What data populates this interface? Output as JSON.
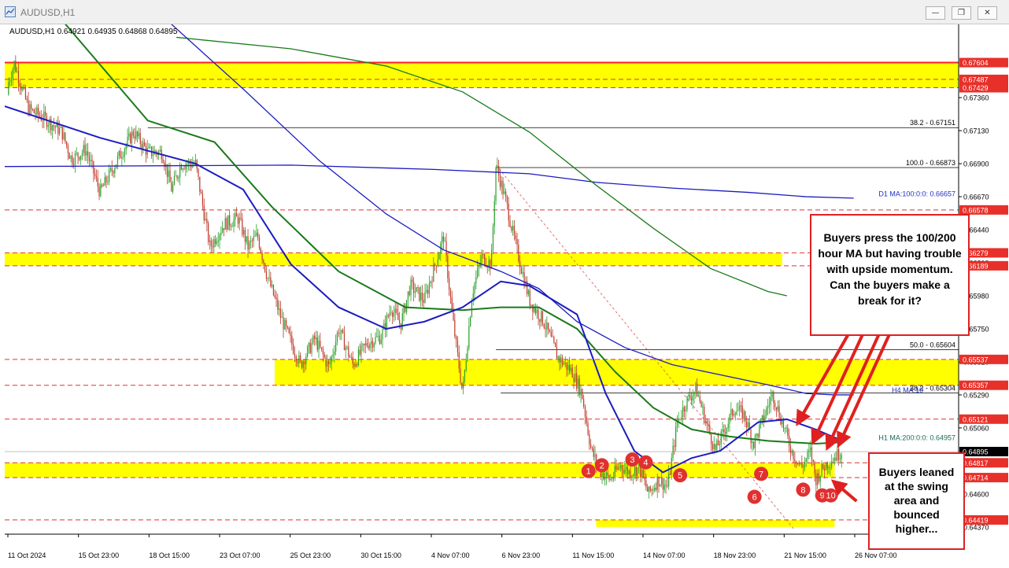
{
  "window": {
    "title": "AUDUSD,H1",
    "minimize_glyph": "—",
    "restore_glyph": "❐",
    "close_glyph": "✕",
    "icon": "chart-window-icon"
  },
  "chart_data": {
    "type": "candlestick",
    "symbol_info": "AUDUSD,H1  0.64921 0.64935 0.64868 0.64895",
    "y_range": [
      0.6432,
      0.6787
    ],
    "price_ticks": [
      {
        "label": "0.67360",
        "value": 0.6736
      },
      {
        "label": "0.67130",
        "value": 0.6713
      },
      {
        "label": "0.66900",
        "value": 0.669
      },
      {
        "label": "0.66670",
        "value": 0.6667
      },
      {
        "label": "0.66440",
        "value": 0.6644
      },
      {
        "label": "0.66210",
        "value": 0.6621
      },
      {
        "label": "0.65980",
        "value": 0.6598
      },
      {
        "label": "0.65750",
        "value": 0.6575
      },
      {
        "label": "0.65520",
        "value": 0.6552
      },
      {
        "label": "0.65290",
        "value": 0.6529
      },
      {
        "label": "0.65060",
        "value": 0.6506
      },
      {
        "label": "0.64830",
        "value": 0.6483
      },
      {
        "label": "0.64600",
        "value": 0.646
      },
      {
        "label": "0.64370",
        "value": 0.6437
      }
    ],
    "price_levels": [
      {
        "label": "0.67604",
        "value": 0.67604,
        "color": "#ff2020",
        "style": "solid"
      },
      {
        "label": "0.67487",
        "value": 0.67487,
        "color": "#e03030",
        "style": "dashed"
      },
      {
        "label": "0.67429",
        "value": 0.67429,
        "color": "#e03030",
        "style": "dashed"
      },
      {
        "label": "0.66578",
        "value": 0.66578,
        "color": "#e03030",
        "style": "dashed"
      },
      {
        "label": "0.66279",
        "value": 0.66279,
        "color": "#e03030",
        "style": "dashed"
      },
      {
        "label": "0.66189",
        "value": 0.66189,
        "color": "#e03030",
        "style": "dashed"
      },
      {
        "label": "0.65537",
        "value": 0.65537,
        "color": "#e03030",
        "style": "dashed"
      },
      {
        "label": "0.65357",
        "value": 0.65357,
        "color": "#e03030",
        "style": "dashed"
      },
      {
        "label": "0.65121",
        "value": 0.65121,
        "color": "#e03030",
        "style": "dashed"
      },
      {
        "label": "0.64817",
        "value": 0.64817,
        "color": "#e03030",
        "style": "dashed"
      },
      {
        "label": "0.64714",
        "value": 0.64714,
        "color": "#e03030",
        "style": "dashed"
      },
      {
        "label": "0.64419",
        "value": 0.64419,
        "color": "#e03030",
        "style": "dashed"
      }
    ],
    "current_price": {
      "label": "0.64895",
      "value": 0.64895
    },
    "zones": [
      {
        "from": 0.67429,
        "to": 0.67604,
        "x_start": 0.0,
        "x_end": 1.0
      },
      {
        "from": 0.66189,
        "to": 0.66279,
        "x_start": 0.0,
        "x_end": 0.815
      },
      {
        "from": 0.65357,
        "to": 0.65537,
        "x_start": 0.283,
        "x_end": 1.0
      },
      {
        "from": 0.64714,
        "to": 0.64817,
        "x_start": 0.0,
        "x_end": 0.87
      },
      {
        "from": 0.6437,
        "to": 0.64419,
        "x_start": 0.62,
        "x_end": 0.87
      }
    ],
    "fibonacci": [
      {
        "label": "100.0 - 0.66873",
        "value": 0.66873
      },
      {
        "label": "50.0 - 0.65604",
        "value": 0.65604
      },
      {
        "label": "38.2 - 0.65304",
        "value": 0.65304
      },
      {
        "label": "38.2 - 0.67151",
        "value": 0.67151
      }
    ],
    "ma_labels": [
      {
        "label": "D1 MA:100:0:0: 0.66657",
        "value": 0.66657,
        "color": "#2030c0"
      },
      {
        "label": "H4 MA:10",
        "value": 0.6529,
        "color": "#2030c0"
      },
      {
        "label": "H1 MA:200:0:0: 0.64957",
        "value": 0.64957,
        "color": "#1a6a5a"
      }
    ],
    "x_tick_labels": [
      "11 Oct 2024",
      "15 Oct 23:00",
      "18 Oct 15:00",
      "23 Oct 07:00",
      "25 Oct 23:00",
      "30 Oct 15:00",
      "4 Nov 07:00",
      "6 Nov 23:00",
      "11 Nov 15:00",
      "14 Nov 07:00",
      "18 Nov 23:00",
      "21 Nov 15:00",
      "26 Nov 07:00"
    ],
    "price_path": [
      [
        0.0,
        0.6738
      ],
      [
        0.01,
        0.676
      ],
      [
        0.025,
        0.6728
      ],
      [
        0.045,
        0.672
      ],
      [
        0.06,
        0.6712
      ],
      [
        0.07,
        0.6693
      ],
      [
        0.085,
        0.67
      ],
      [
        0.1,
        0.667
      ],
      [
        0.12,
        0.6695
      ],
      [
        0.135,
        0.6712
      ],
      [
        0.15,
        0.6698
      ],
      [
        0.165,
        0.6698
      ],
      [
        0.175,
        0.6672
      ],
      [
        0.185,
        0.669
      ],
      [
        0.2,
        0.669
      ],
      [
        0.215,
        0.6632
      ],
      [
        0.23,
        0.6648
      ],
      [
        0.245,
        0.6652
      ],
      [
        0.255,
        0.6632
      ],
      [
        0.265,
        0.664
      ],
      [
        0.275,
        0.6612
      ],
      [
        0.29,
        0.6582
      ],
      [
        0.31,
        0.655
      ],
      [
        0.325,
        0.6568
      ],
      [
        0.34,
        0.6548
      ],
      [
        0.35,
        0.6575
      ],
      [
        0.365,
        0.655
      ],
      [
        0.38,
        0.6565
      ],
      [
        0.395,
        0.657
      ],
      [
        0.405,
        0.659
      ],
      [
        0.415,
        0.6578
      ],
      [
        0.425,
        0.6605
      ],
      [
        0.44,
        0.6595
      ],
      [
        0.455,
        0.6628
      ],
      [
        0.46,
        0.664
      ],
      [
        0.47,
        0.658
      ],
      [
        0.48,
        0.653
      ],
      [
        0.49,
        0.66
      ],
      [
        0.5,
        0.6625
      ],
      [
        0.51,
        0.662
      ],
      [
        0.515,
        0.6689
      ],
      [
        0.525,
        0.6665
      ],
      [
        0.535,
        0.6635
      ],
      [
        0.55,
        0.6595
      ],
      [
        0.565,
        0.658
      ],
      [
        0.58,
        0.6555
      ],
      [
        0.595,
        0.6545
      ],
      [
        0.605,
        0.653
      ],
      [
        0.615,
        0.649
      ],
      [
        0.625,
        0.6475
      ],
      [
        0.635,
        0.647
      ],
      [
        0.645,
        0.648
      ],
      [
        0.655,
        0.6475
      ],
      [
        0.665,
        0.6478
      ],
      [
        0.675,
        0.646
      ],
      [
        0.685,
        0.647
      ],
      [
        0.695,
        0.6465
      ],
      [
        0.705,
        0.651
      ],
      [
        0.715,
        0.6525
      ],
      [
        0.725,
        0.6533
      ],
      [
        0.735,
        0.651
      ],
      [
        0.745,
        0.649
      ],
      [
        0.755,
        0.6505
      ],
      [
        0.765,
        0.652
      ],
      [
        0.775,
        0.6515
      ],
      [
        0.785,
        0.6495
      ],
      [
        0.795,
        0.6512
      ],
      [
        0.805,
        0.653
      ],
      [
        0.815,
        0.651
      ],
      [
        0.825,
        0.649
      ],
      [
        0.835,
        0.6478
      ],
      [
        0.845,
        0.649
      ],
      [
        0.85,
        0.647
      ],
      [
        0.86,
        0.648
      ],
      [
        0.87,
        0.6486
      ],
      [
        0.878,
        0.649
      ]
    ],
    "ma_100_h1_path": [
      [
        0.0,
        0.673
      ],
      [
        0.1,
        0.6708
      ],
      [
        0.2,
        0.669
      ],
      [
        0.25,
        0.6672
      ],
      [
        0.3,
        0.662
      ],
      [
        0.35,
        0.659
      ],
      [
        0.4,
        0.6575
      ],
      [
        0.44,
        0.658
      ],
      [
        0.48,
        0.659
      ],
      [
        0.52,
        0.6608
      ],
      [
        0.55,
        0.6605
      ],
      [
        0.6,
        0.6585
      ],
      [
        0.63,
        0.653
      ],
      [
        0.66,
        0.649
      ],
      [
        0.69,
        0.6475
      ],
      [
        0.72,
        0.6485
      ],
      [
        0.75,
        0.649
      ],
      [
        0.79,
        0.651
      ],
      [
        0.82,
        0.6512
      ],
      [
        0.85,
        0.6505
      ],
      [
        0.878,
        0.6497
      ]
    ],
    "ma_200_h1_path": [
      [
        0.06,
        0.679
      ],
      [
        0.15,
        0.672
      ],
      [
        0.22,
        0.6705
      ],
      [
        0.28,
        0.666
      ],
      [
        0.35,
        0.6615
      ],
      [
        0.42,
        0.659
      ],
      [
        0.48,
        0.6588
      ],
      [
        0.52,
        0.659
      ],
      [
        0.56,
        0.659
      ],
      [
        0.6,
        0.6575
      ],
      [
        0.64,
        0.6545
      ],
      [
        0.68,
        0.652
      ],
      [
        0.72,
        0.6505
      ],
      [
        0.76,
        0.65
      ],
      [
        0.8,
        0.6497
      ],
      [
        0.85,
        0.6495
      ],
      [
        0.878,
        0.6496
      ]
    ],
    "ma_200_h4_path": [
      [
        0.17,
        0.679
      ],
      [
        0.25,
        0.6742
      ],
      [
        0.33,
        0.6692
      ],
      [
        0.4,
        0.6655
      ],
      [
        0.46,
        0.663
      ],
      [
        0.52,
        0.6615
      ],
      [
        0.56,
        0.6603
      ],
      [
        0.6,
        0.658
      ],
      [
        0.65,
        0.6562
      ],
      [
        0.7,
        0.655
      ],
      [
        0.75,
        0.6543
      ],
      [
        0.8,
        0.6536
      ],
      [
        0.84,
        0.653
      ],
      [
        0.87,
        0.6529
      ],
      [
        0.89,
        0.6529
      ]
    ],
    "ma_d1_100_path": [
      [
        0.0,
        0.6688
      ],
      [
        0.3,
        0.6689
      ],
      [
        0.45,
        0.6686
      ],
      [
        0.55,
        0.6683
      ],
      [
        0.62,
        0.6677
      ],
      [
        0.7,
        0.6673
      ],
      [
        0.78,
        0.667
      ],
      [
        0.84,
        0.6667
      ],
      [
        0.89,
        0.6666
      ]
    ],
    "ma_d1_200_path": [
      [
        0.18,
        0.6778
      ],
      [
        0.3,
        0.677
      ],
      [
        0.4,
        0.6758
      ],
      [
        0.48,
        0.674
      ],
      [
        0.55,
        0.6712
      ],
      [
        0.62,
        0.6675
      ],
      [
        0.68,
        0.6645
      ],
      [
        0.74,
        0.6617
      ],
      [
        0.8,
        0.6601
      ],
      [
        0.82,
        0.6598
      ]
    ],
    "trendline": [
      [
        0.515,
        0.6689
      ],
      [
        0.828,
        0.6435
      ]
    ],
    "swing_labels": [
      {
        "label": "1",
        "x": 0.612,
        "y": 0.6476
      },
      {
        "label": "2",
        "x": 0.626,
        "y": 0.648
      },
      {
        "label": "3",
        "x": 0.658,
        "y": 0.6484
      },
      {
        "label": "4",
        "x": 0.672,
        "y": 0.6482
      },
      {
        "label": "5",
        "x": 0.708,
        "y": 0.6473
      },
      {
        "label": "6",
        "x": 0.786,
        "y": 0.6458
      },
      {
        "label": "7",
        "x": 0.793,
        "y": 0.6474
      },
      {
        "label": "8",
        "x": 0.837,
        "y": 0.6463
      },
      {
        "label": "9",
        "x": 0.857,
        "y": 0.6459
      },
      {
        "label": "10",
        "x": 0.866,
        "y": 0.6459
      }
    ],
    "arrows": [
      {
        "from": [
          0.885,
          0.6572
        ],
        "to": [
          0.832,
          0.651
        ]
      },
      {
        "from": [
          0.9,
          0.6572
        ],
        "to": [
          0.848,
          0.6497
        ]
      },
      {
        "from": [
          0.917,
          0.6572
        ],
        "to": [
          0.863,
          0.6493
        ]
      },
      {
        "from": [
          0.928,
          0.6572
        ],
        "to": [
          0.875,
          0.6495
        ]
      },
      {
        "from": [
          0.893,
          0.6455
        ],
        "to": [
          0.87,
          0.6468
        ]
      }
    ]
  },
  "callouts": {
    "top": "Buyers press the 100/200 hour MA but having trouble with upside momentum.   Can the buyers make a break for it?",
    "bottom": "Buyers leaned at the swing area and bounced higher..."
  },
  "colors": {
    "zone": "#ffff00",
    "candle_up": "#2ca02c",
    "candle_down": "#c0392b",
    "ma_blue": "#1c1cc0",
    "ma_green": "#1a7a1a",
    "grid": "#000000",
    "swing_marker": "#e03030"
  }
}
